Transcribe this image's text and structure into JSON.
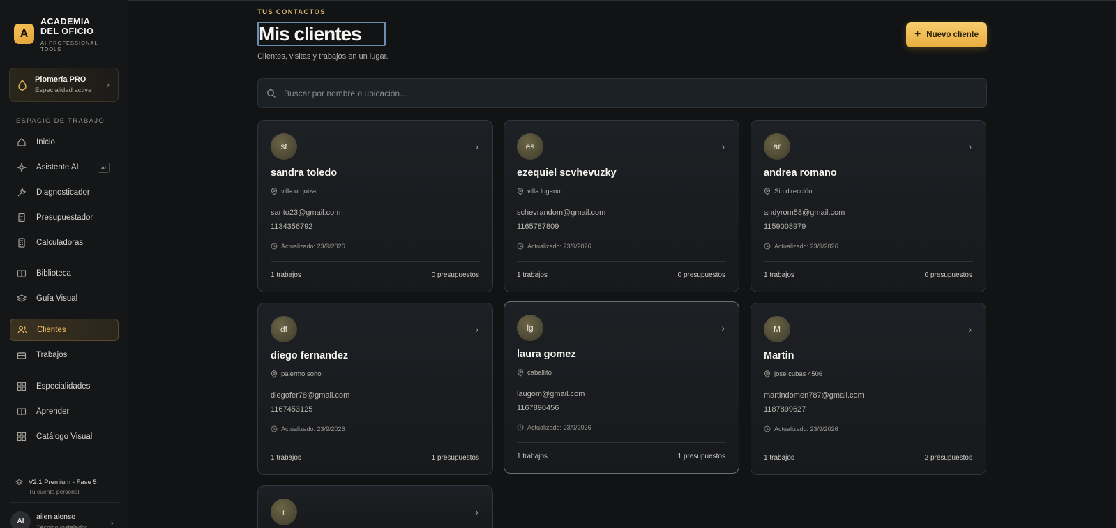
{
  "brand": {
    "logo_letter": "A",
    "name": "ACADEMIA DEL OFICIO",
    "tagline": "AI PROFESSIONAL TOOLS"
  },
  "specialty": {
    "title": "Plomería PRO",
    "subtitle": "Especialidad activa",
    "icon": "drop-icon"
  },
  "sidebar": {
    "section_label": "ESPACIO DE TRABAJO",
    "items": [
      {
        "label": "Inicio",
        "icon": "home-icon"
      },
      {
        "label": "Asistente AI",
        "icon": "sparkle-icon",
        "badge": "AI"
      },
      {
        "label": "Diagnosticador",
        "icon": "wrench-icon"
      },
      {
        "label": "Presupuestador",
        "icon": "document-icon"
      },
      {
        "label": "Calculadoras",
        "icon": "calculator-icon"
      },
      {
        "label": "Biblioteca",
        "icon": "book-icon"
      },
      {
        "label": "Guía Visual",
        "icon": "layers-icon"
      },
      {
        "label": "Clientes",
        "icon": "users-icon",
        "active": true
      },
      {
        "label": "Trabajos",
        "icon": "briefcase-icon"
      },
      {
        "label": "Especialidades",
        "icon": "grid-icon"
      },
      {
        "label": "Aprender",
        "icon": "open-book-icon"
      },
      {
        "label": "Catálogo Visual",
        "icon": "grid-icon"
      }
    ],
    "version": {
      "title": "V2.1 Premium - Fase 5",
      "subtitle": "Tu cuenta personal"
    },
    "user": {
      "initials": "AI",
      "name": "ailen alonso",
      "role": "Técnico instalador"
    }
  },
  "header": {
    "eyebrow": "TUS CONTACTOS",
    "title": "Mis clientes",
    "subtitle": "Clientes, visitas y trabajos en un lugar.",
    "new_button": "Nuevo cliente"
  },
  "search": {
    "placeholder": "Buscar por nombre o ubicación..."
  },
  "clients": [
    {
      "initials": "st",
      "name": "sandra toledo",
      "location": "villa urquiza",
      "email": "santo23@gmail.com",
      "phone": "1134356792",
      "updated": "Actualizado: 23/9/2026",
      "jobs": "1 trabajos",
      "quotes": "0 presupuestos"
    },
    {
      "initials": "es",
      "name": "ezequiel scvhevuzky",
      "location": "villa lugano",
      "email": "schevrandom@gmail.com",
      "phone": "1165787809",
      "updated": "Actualizado: 23/9/2026",
      "jobs": "1 trabajos",
      "quotes": "0 presupuestos"
    },
    {
      "initials": "ar",
      "name": "andrea romano",
      "location": "Sin dirección",
      "email": "andyrom58@gmail.com",
      "phone": "1159008979",
      "updated": "Actualizado: 23/9/2026",
      "jobs": "1 trabajos",
      "quotes": "0 presupuestos"
    },
    {
      "initials": "df",
      "name": "diego fernandez",
      "location": "palermo soho",
      "email": "diegofer78@gmail.com",
      "phone": "1167453125",
      "updated": "Actualizado: 23/9/2026",
      "jobs": "1 trabajos",
      "quotes": "1 presupuestos"
    },
    {
      "initials": "lg",
      "name": "laura gomez",
      "location": "caballito",
      "email": "laugom@gmail.com",
      "phone": "1167890456",
      "updated": "Actualizado: 23/9/2026",
      "jobs": "1 trabajos",
      "quotes": "1 presupuestos"
    },
    {
      "initials": "M",
      "name": "Martin",
      "location": "jose cubas 4506",
      "email": "martindomen787@gmail.com",
      "phone": "1187899627",
      "updated": "Actualizado: 23/9/2026",
      "jobs": "1 trabajos",
      "quotes": "2 presupuestos"
    },
    {
      "initials": "r"
    }
  ],
  "colors": {
    "accent": "#f1c065",
    "background": "#111315",
    "card": "#1d2024"
  }
}
